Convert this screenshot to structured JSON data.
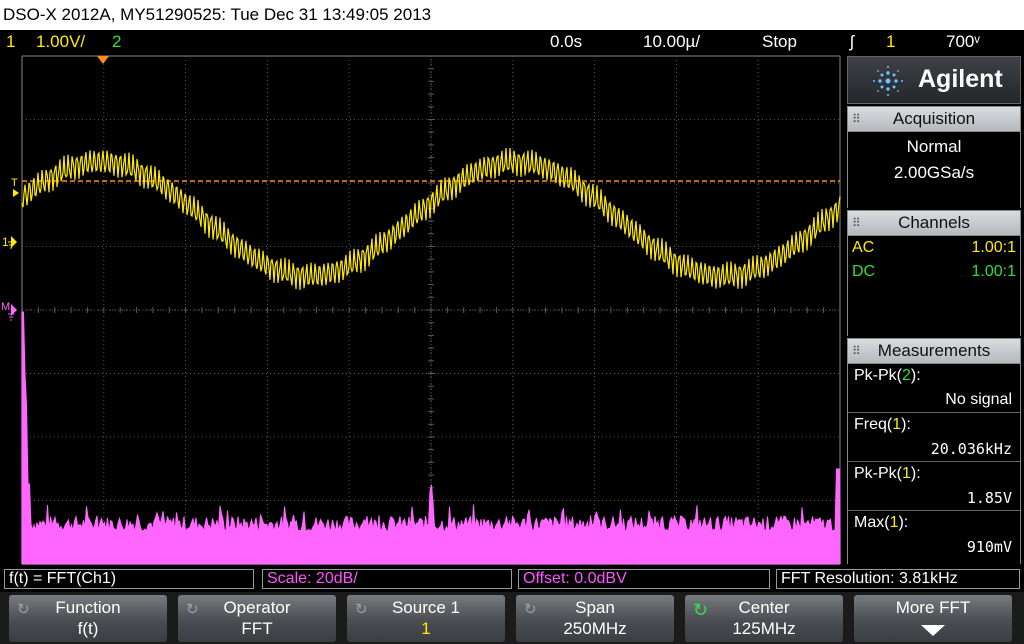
{
  "title": "DSO-X 2012A, MY51290525: Tue Dec 31 13:49:05 2013",
  "status": {
    "ch1_num": "1",
    "ch1_scale": "1.00V/",
    "ch2_num": "2",
    "time_delay": "0.0s",
    "time_scale": "10.00µ/",
    "run_state": "Stop",
    "trigger_icon": "ʃ",
    "trigger_source": "1",
    "trigger_level": "700ᵛ"
  },
  "markers": {
    "trigger": "T",
    "ch1": "1",
    "math": "M"
  },
  "brand": {
    "logo_icon": "agilent-spark-icon",
    "name": "Agilent"
  },
  "acquisition": {
    "header": "Acquisition",
    "mode": "Normal",
    "rate": "2.00GSa/s"
  },
  "channels": {
    "header": "Channels",
    "rows": [
      {
        "label": "AC",
        "value": "1.00:1"
      },
      {
        "label": "DC",
        "value": "1.00:1"
      }
    ]
  },
  "measurements": {
    "header": "Measurements",
    "items": [
      {
        "name": "Pk-Pk(",
        "ch": "2",
        "close": "):",
        "value": "No signal"
      },
      {
        "name": "Freq(",
        "ch": "1",
        "close": "):",
        "value": "20.036kHz"
      },
      {
        "name": "Pk-Pk(",
        "ch": "1",
        "close": "):",
        "value": "1.85V"
      },
      {
        "name": "Max(",
        "ch": "1",
        "close": "):",
        "value": "910mV"
      }
    ]
  },
  "infobar": {
    "function": "f(t) = FFT(Ch1)",
    "scale": "Scale: 20dB/",
    "offset": "Offset: 0.0dBV",
    "resolution": "FFT Resolution: 3.81kHz"
  },
  "softkeys": [
    {
      "top": "Function",
      "bottom": "f(t)"
    },
    {
      "top": "Operator",
      "bottom": "FFT"
    },
    {
      "top": "Source 1",
      "bottom": "1"
    },
    {
      "top": "Span",
      "bottom": "250MHz"
    },
    {
      "top": "Center",
      "bottom": "125MHz"
    },
    {
      "top": "More FFT",
      "bottom": ""
    }
  ],
  "colors": {
    "ch1": "#ffea00",
    "ch2": "#33dd33",
    "math": "#ff66ff",
    "trigger": "#ff8c1a",
    "grid": "#6a6a6a"
  }
}
